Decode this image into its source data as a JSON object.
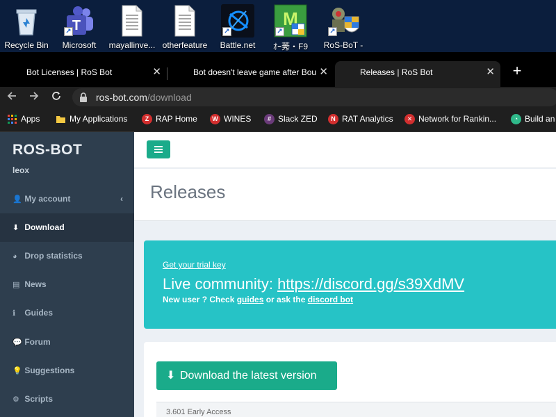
{
  "desktop": {
    "icons": [
      {
        "label": "Recycle Bin",
        "icon": "recycle-bin-icon"
      },
      {
        "label": "Microsoft",
        "icon": "teams-icon"
      },
      {
        "label": "mayallinve...",
        "icon": "document-icon"
      },
      {
        "label": "otherfeature",
        "icon": "document-icon"
      },
      {
        "label": "Battle.net",
        "icon": "battlenet-icon"
      },
      {
        "label": "ｵｰ莠・F9",
        "icon": "app-icon"
      },
      {
        "label": "RoS-BoT -",
        "icon": "rosbot-app-icon"
      }
    ]
  },
  "browser": {
    "tabs": [
      {
        "title": "Bot Licenses | RoS Bot",
        "active": false
      },
      {
        "title": "Bot doesn't leave game after Bou",
        "active": false
      },
      {
        "title": "Releases | RoS Bot",
        "active": true
      }
    ],
    "close_glyph": "✕",
    "new_tab_glyph": "+",
    "url_domain": "ros-bot.com",
    "url_path": "/download",
    "bookmarks": [
      {
        "label": "Apps",
        "icon": "apps-grid-icon",
        "color": "#e8453c"
      },
      {
        "label": "My Applications",
        "icon": "folder-icon",
        "color": "#f4c842"
      },
      {
        "label": "RAP Home",
        "icon": "rap-icon",
        "color": "#d32f2f"
      },
      {
        "label": "WINES",
        "icon": "wines-icon",
        "color": "#d32f2f"
      },
      {
        "label": "Slack ZED",
        "icon": "slack-icon",
        "color": "#6b3b7a"
      },
      {
        "label": "RAT Analytics",
        "icon": "rat-icon",
        "color": "#d32f2f"
      },
      {
        "label": "Network for Rankin...",
        "icon": "network-icon",
        "color": "#d32f2f"
      },
      {
        "label": "Build an",
        "icon": "build-icon",
        "color": "#2fb98a"
      }
    ]
  },
  "sidebar": {
    "brand": "ROS-BOT",
    "username": "leox",
    "items": [
      {
        "label": "My account",
        "icon": "user-icon",
        "glyph": "👤",
        "active": false,
        "has_chevron": true
      },
      {
        "label": "Download",
        "icon": "download-icon",
        "glyph": "⬇",
        "active": true,
        "has_chevron": false
      },
      {
        "label": "Drop statistics",
        "icon": "pie-chart-icon",
        "glyph": "◕",
        "active": false,
        "has_chevron": false
      },
      {
        "label": "News",
        "icon": "newspaper-icon",
        "glyph": "▤",
        "active": false,
        "has_chevron": false
      },
      {
        "label": "Guides",
        "icon": "info-icon",
        "glyph": "ℹ",
        "active": false,
        "has_chevron": false
      },
      {
        "label": "Forum",
        "icon": "comments-icon",
        "glyph": "💬",
        "active": false,
        "has_chevron": false
      },
      {
        "label": "Suggestions",
        "icon": "lightbulb-icon",
        "glyph": "💡",
        "active": false,
        "has_chevron": false
      },
      {
        "label": "Scripts",
        "icon": "gears-icon",
        "glyph": "⚙",
        "active": false,
        "has_chevron": false
      }
    ],
    "chevron_glyph": "‹"
  },
  "main": {
    "page_title": "Releases",
    "callout": {
      "trial_link": "Get your trial key",
      "community_prefix": "Live community: ",
      "community_link": "https://discord.gg/s39XdMV",
      "newuser_prefix": "New user ? Check ",
      "guides_link": "guides",
      "newuser_middle": " or ask the ",
      "discord_bot_link": "discord bot"
    },
    "download_button": "Download the latest version",
    "download_glyph": "⬇",
    "version_text": "3.601 Early Access"
  },
  "colors": {
    "sidebar_bg": "#2e3e4e",
    "accent_green": "#1aab8a",
    "callout_teal": "#26c3c6"
  }
}
